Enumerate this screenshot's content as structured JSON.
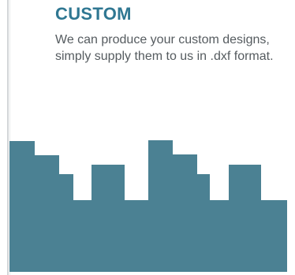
{
  "section": {
    "title": "CUSTOM",
    "description": "We can produce your custom designs, simply supply them to us in .dxf format."
  },
  "colors": {
    "title": "#2f7792",
    "profile_fill": "#4b8193",
    "text": "#555b5f"
  },
  "graphic": {
    "icon": "custom-profile-shape-icon"
  }
}
